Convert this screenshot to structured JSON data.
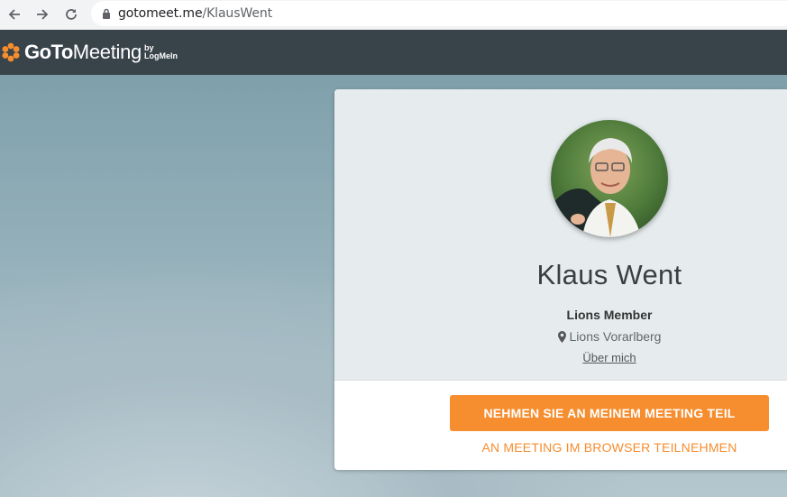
{
  "browser": {
    "url_host": "gotomeet.me",
    "url_path": "/KlausWent"
  },
  "brand": {
    "goto": "GoTo",
    "meeting": "Meeting",
    "by": "by",
    "logmein": "LogMeIn",
    "accent": "#f68d2e"
  },
  "profile": {
    "name": "Klaus Went",
    "role": "Lions Member",
    "location": "Lions Vorarlberg",
    "about_link": "Über mich"
  },
  "actions": {
    "join_button": "NEHMEN SIE AN MEINEM MEETING TEIL",
    "browser_link": "AN MEETING IM BROWSER TEILNEHMEN"
  }
}
